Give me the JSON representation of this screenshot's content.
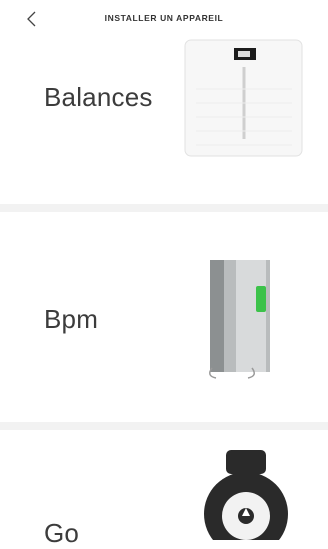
{
  "header": {
    "back_label": "Retour",
    "title": "INSTALLER UN APPAREIL"
  },
  "devices": [
    {
      "label": "Balances",
      "icon": "smart-scale-icon"
    },
    {
      "label": "Bpm",
      "icon": "blood-pressure-monitor-icon"
    },
    {
      "label": "Go",
      "icon": "activity-tracker-icon"
    }
  ],
  "colors": {
    "divider": "#f2f2f2",
    "accent_green": "#3cc24a",
    "text": "#3c3c3c"
  }
}
